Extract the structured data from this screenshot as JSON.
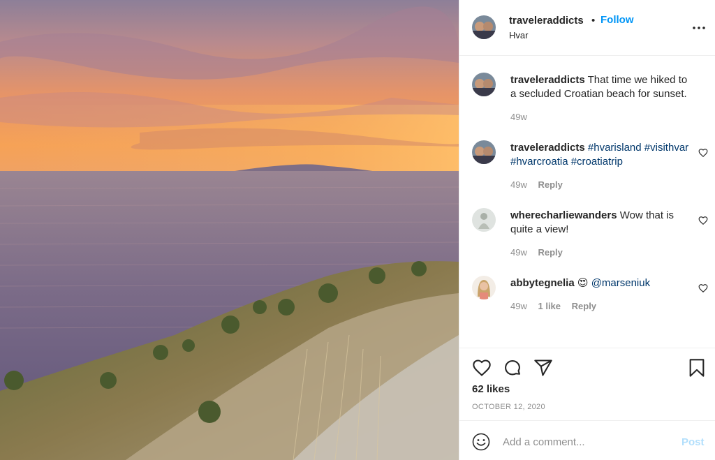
{
  "header": {
    "username": "traveleraddicts",
    "separator": "•",
    "follow_label": "Follow",
    "location": "Hvar"
  },
  "comments": [
    {
      "user": "traveleraddicts",
      "text": "That time we hiked to a secluded Croatian beach for sunset.",
      "time": "49w"
    },
    {
      "user": "traveleraddicts",
      "tags": [
        "#hvarisland",
        "#visithvar",
        "#hvarcroatia",
        "#croatiatrip"
      ],
      "time": "49w",
      "reply_label": "Reply"
    },
    {
      "user": "wherecharliewanders",
      "text": "Wow that is quite a view!",
      "time": "49w",
      "reply_label": "Reply"
    },
    {
      "user": "abbytegnelia",
      "emoji": "😍",
      "mention": "@marseniuk",
      "time": "49w",
      "likes": "1 like",
      "reply_label": "Reply"
    }
  ],
  "actions": {
    "likes": "62 likes",
    "date": "OCTOBER 12, 2020"
  },
  "composer": {
    "placeholder": "Add a comment...",
    "post_label": "Post"
  },
  "colors": {
    "follow": "#0095f6",
    "hashtag": "#00376b",
    "muted": "#8e8e8e",
    "post_disabled": "#b2dffc"
  },
  "icons": [
    "more-icon",
    "heart-icon",
    "comment-icon",
    "share-icon",
    "bookmark-icon",
    "emoji-icon"
  ]
}
